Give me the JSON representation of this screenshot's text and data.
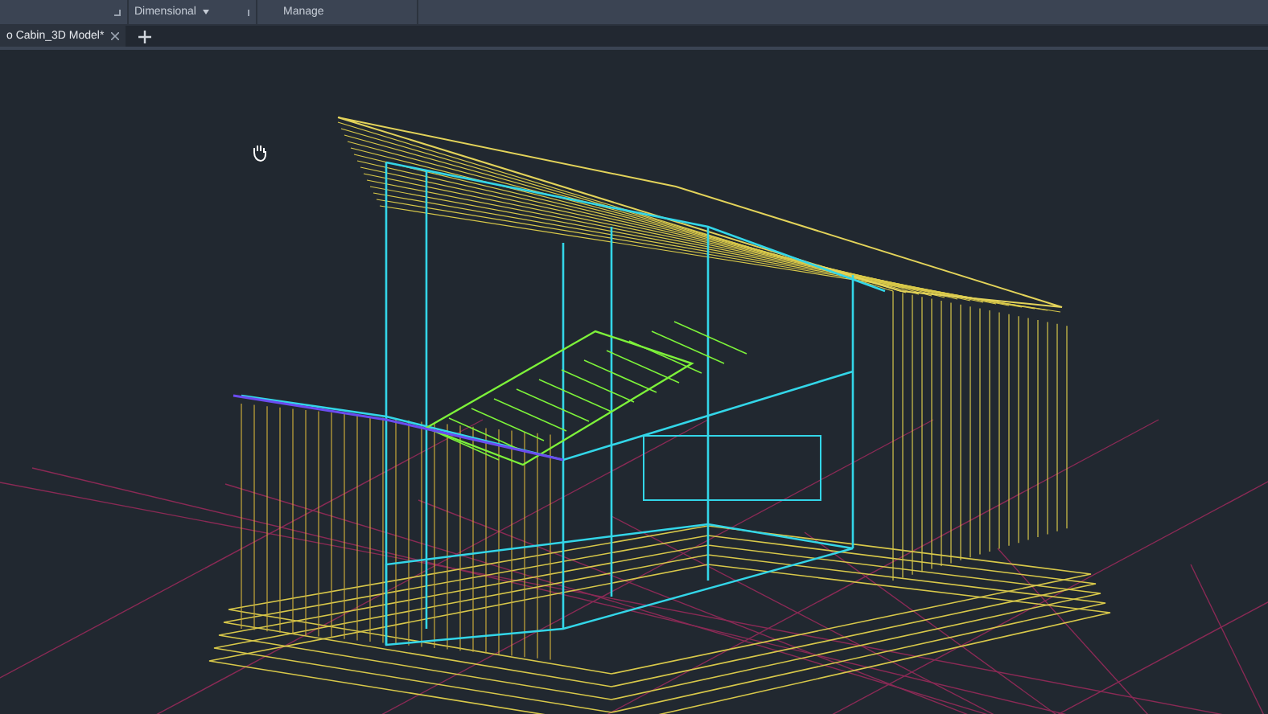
{
  "ribbon": {
    "panels": [
      {
        "label": "Dimensional",
        "has_dropdown": true
      },
      {
        "label": "Manage",
        "has_dropdown": false
      }
    ]
  },
  "document_tabs": [
    {
      "label": "o Cabin_3D Model*",
      "selected": true
    }
  ]
}
